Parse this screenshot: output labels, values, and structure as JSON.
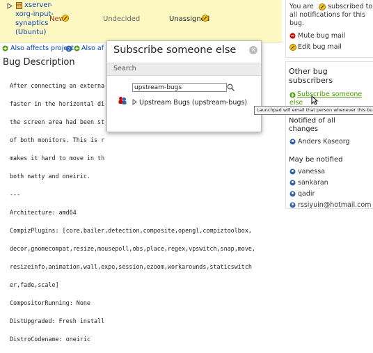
{
  "status_row": {
    "package": "xserver-xorg-input-synaptics (Ubuntu)",
    "package_lines": [
      "xserver-",
      "xorg-input-",
      "synaptics",
      "(Ubuntu)"
    ],
    "status": "New",
    "importance": "Undecided",
    "assignee": "Unassigned"
  },
  "affects": {
    "also_affects_project": "Also affects project",
    "also_affects_distribution": "Also af"
  },
  "description": {
    "heading": "Bug Description",
    "lines": [
      "After connecting an externa",
      "faster in the horizontal di",
      "the screen area had been st",
      "of both monitors. This is r",
      "makes it hard to move in th",
      "both natty and oneiric.",
      "---",
      "Architecture: amd64",
      "CompizPlugins: [core,bailer,detection,composite,opengl,compiztoolbox,",
      "decor,gnomecompat,resize,mousepoll,obs,place,regex,vpswitch,snap,move,",
      "resizeinfo,animation,wall,expo,session,ezoom,workarounds,staticswitch",
      "er,fade,scale]",
      "CompositorRunning: None",
      "DistUpgraded: Fresh install",
      "DistroCodename: oneiric"
    ]
  },
  "sidebar": {
    "subscription_lines": [
      "You are",
      "subscribed to",
      "all notifications for this",
      "bug."
    ],
    "mute_label": "Mute bug mail",
    "edit_label": "Edit bug mail",
    "other_title_lines": [
      "Other bug",
      "subscribers"
    ],
    "subscribe_lines": [
      "Subscribe someone",
      "else"
    ],
    "notified_all_lines": [
      "Notified of all",
      "changes"
    ],
    "notified_all_user": "Anders Kaseorg",
    "maybe_title": "May be notified",
    "maybe_users": [
      "vanessa",
      "sankaran",
      "qadir",
      "rssiyuin@hotmail.com"
    ]
  },
  "modal": {
    "title": "Subscribe someone else",
    "close": "×",
    "band_label": "Search",
    "search_value": "upstream-bugs",
    "result_label": "Upstream Bugs (upstream-bugs)"
  },
  "tooltip": {
    "text": "Launchpad will email that person whenever this bugs chang"
  },
  "colors": {
    "status_bg": "#fdf8c1",
    "link": "#0645ad",
    "new_status": "#993300"
  }
}
